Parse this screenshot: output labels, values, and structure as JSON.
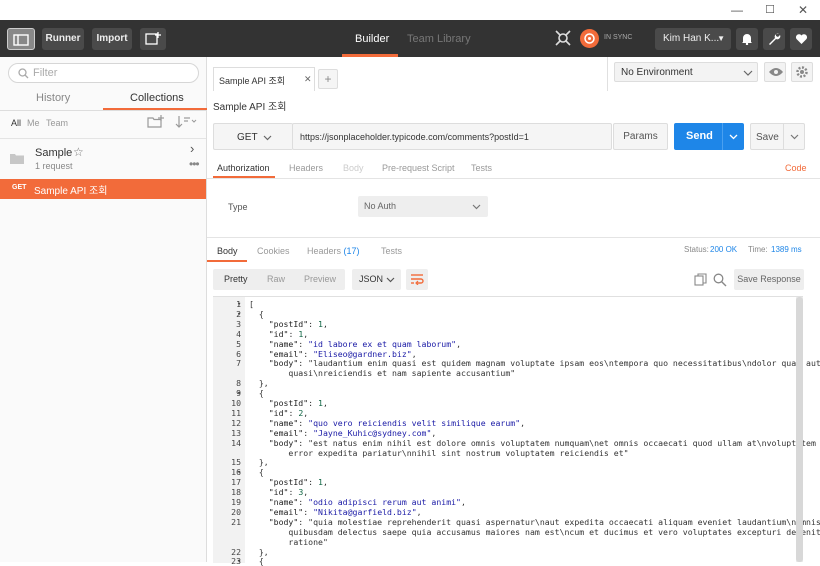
{
  "window": {
    "minimize": "—",
    "maximize": "☐",
    "close": "✕"
  },
  "toolbar": {
    "runner": "Runner",
    "import": "Import",
    "tabs": [
      {
        "label": "Builder"
      },
      {
        "label": "Team Library"
      }
    ],
    "sync": "IN SYNC",
    "user": "Kim Han K..."
  },
  "sidebar": {
    "filter_placeholder": "Filter",
    "tabs": [
      {
        "label": "History"
      },
      {
        "label": "Collections"
      }
    ],
    "filters": [
      "All",
      "Me",
      "Team"
    ],
    "collection": {
      "name": "Sample",
      "count": "1 request"
    },
    "request": {
      "method": "GET",
      "name": "Sample API 조회"
    }
  },
  "request_tab": {
    "label": "Sample API 조회",
    "add": "+"
  },
  "environment": {
    "selected": "No Environment"
  },
  "request": {
    "title": "Sample API 조회",
    "method": "GET",
    "url": "https://jsonplaceholder.typicode.com/comments?postId=1",
    "params": "Params",
    "send": "Send",
    "save": "Save"
  },
  "request_tabs": [
    {
      "label": "Authorization"
    },
    {
      "label": "Headers"
    },
    {
      "label": "Body"
    },
    {
      "label": "Pre-request Script"
    },
    {
      "label": "Tests"
    }
  ],
  "code_link": "Code",
  "auth": {
    "type_label": "Type",
    "type_value": "No Auth"
  },
  "response": {
    "tabs": [
      "Body",
      "Cookies",
      "Headers",
      "Tests"
    ],
    "headers_count": "(17)",
    "status_label": "Status:",
    "status_value": "200 OK",
    "time_label": "Time:",
    "time_value": "1389 ms",
    "views": [
      "Pretty",
      "Raw",
      "Preview"
    ],
    "format": "JSON",
    "save_response": "Save Response"
  },
  "code_lines": [
    {
      "n": "1",
      "f": "▾",
      "t": "["
    },
    {
      "n": "2",
      "f": "▾",
      "t": "  {"
    },
    {
      "n": "3",
      "t": "    \"postId\": 1,"
    },
    {
      "n": "4",
      "t": "    \"id\": 1,"
    },
    {
      "n": "5",
      "t": "    \"name\": \"id labore ex et quam laborum\","
    },
    {
      "n": "6",
      "t": "    \"email\": \"Eliseo@gardner.biz\","
    },
    {
      "n": "7",
      "t": "    \"body\": \"laudantium enim quasi est quidem magnam voluptate ipsam eos\\ntempora quo necessitatibus\\ndolor quam autem"
    },
    {
      "n": "",
      "t": "        quasi\\nreiciendis et nam sapiente accusantium\""
    },
    {
      "n": "8",
      "t": "  },"
    },
    {
      "n": "9",
      "f": "▾",
      "t": "  {"
    },
    {
      "n": "10",
      "t": "    \"postId\": 1,"
    },
    {
      "n": "11",
      "t": "    \"id\": 2,"
    },
    {
      "n": "12",
      "t": "    \"name\": \"quo vero reiciendis velit similique earum\","
    },
    {
      "n": "13",
      "t": "    \"email\": \"Jayne_Kuhic@sydney.com\","
    },
    {
      "n": "14",
      "t": "    \"body\": \"est natus enim nihil est dolore omnis voluptatem numquam\\net omnis occaecati quod ullam at\\nvoluptatem"
    },
    {
      "n": "",
      "t": "        error expedita pariatur\\nnihil sint nostrum voluptatem reiciendis et\""
    },
    {
      "n": "15",
      "t": "  },"
    },
    {
      "n": "16",
      "f": "▾",
      "t": "  {"
    },
    {
      "n": "17",
      "t": "    \"postId\": 1,"
    },
    {
      "n": "18",
      "t": "    \"id\": 3,"
    },
    {
      "n": "19",
      "t": "    \"name\": \"odio adipisci rerum aut animi\","
    },
    {
      "n": "20",
      "t": "    \"email\": \"Nikita@garfield.biz\","
    },
    {
      "n": "21",
      "t": "    \"body\": \"quia molestiae reprehenderit quasi aspernatur\\naut expedita occaecati aliquam eveniet laudantium\\nomnis"
    },
    {
      "n": "",
      "t": "        quibusdam delectus saepe quia accusamus maiores nam est\\ncum et ducimus et vero voluptates excepturi deleniti"
    },
    {
      "n": "",
      "t": "        ratione\""
    },
    {
      "n": "22",
      "t": "  },"
    },
    {
      "n": "23",
      "f": "▾",
      "t": "  {"
    }
  ]
}
